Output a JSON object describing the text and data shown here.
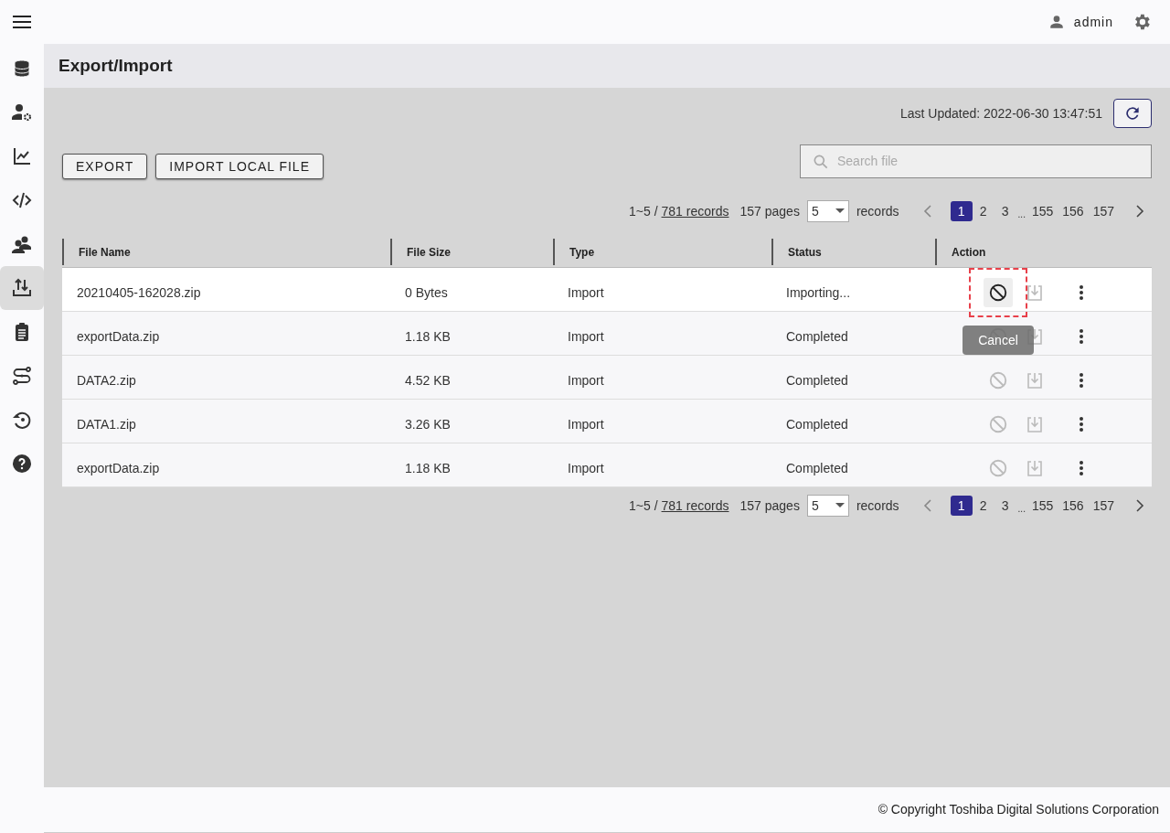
{
  "header": {
    "user": "admin"
  },
  "sidebar": {
    "items": [
      {
        "kind": "database",
        "selected": false
      },
      {
        "kind": "usergear",
        "selected": false
      },
      {
        "kind": "chart",
        "selected": false
      },
      {
        "kind": "code",
        "selected": false
      },
      {
        "kind": "users",
        "selected": false
      },
      {
        "kind": "transfer",
        "selected": true
      },
      {
        "kind": "clipboard",
        "selected": false
      },
      {
        "kind": "route",
        "selected": false
      },
      {
        "kind": "restore",
        "selected": false
      },
      {
        "kind": "help",
        "selected": false
      }
    ]
  },
  "page_title": "Export/Import",
  "last_updated": "Last Updated: 2022-06-30 13:47:51",
  "buttons": [
    "EXPORT",
    "IMPORT LOCAL FILE"
  ],
  "search": {
    "placeholder": "Search file"
  },
  "top_pagination": {
    "range": "1~5 /",
    "records_link": "781 records",
    "pages": "157 pages",
    "page_size": "5",
    "records_label": "records",
    "pages_list": [
      {
        "kind": "page",
        "label": "1",
        "selected": true
      },
      {
        "kind": "page",
        "label": "2",
        "selected": false
      },
      {
        "kind": "page",
        "label": "3",
        "selected": false
      },
      {
        "kind": "ellipsis",
        "label": "..."
      },
      {
        "kind": "page",
        "label": "155",
        "selected": false
      },
      {
        "kind": "page",
        "label": "156",
        "selected": false
      },
      {
        "kind": "page",
        "label": "157",
        "selected": false
      }
    ]
  },
  "table": {
    "columns": [
      "File Name",
      "File Size",
      "Type",
      "Status",
      "Action"
    ],
    "rows": [
      {
        "file_name": "20210405-162028.zip",
        "file_size": "0 Bytes",
        "type": "Import",
        "status": "Importing...",
        "cancel_enabled": true,
        "highlighted": true
      },
      {
        "file_name": "exportData.zip",
        "file_size": "1.18 KB",
        "type": "Import",
        "status": "Completed",
        "cancel_enabled": false,
        "highlighted": false
      },
      {
        "file_name": "DATA2.zip",
        "file_size": "4.52 KB",
        "type": "Import",
        "status": "Completed",
        "cancel_enabled": false,
        "highlighted": false
      },
      {
        "file_name": "DATA1.zip",
        "file_size": "3.26 KB",
        "type": "Import",
        "status": "Completed",
        "cancel_enabled": false,
        "highlighted": false
      },
      {
        "file_name": "exportData.zip",
        "file_size": "1.18 KB",
        "type": "Import",
        "status": "Completed",
        "cancel_enabled": false,
        "highlighted": false
      }
    ]
  },
  "tooltip": {
    "text": "Cancel"
  },
  "bottom_pagination": {
    "range": "1~5 /",
    "records_link": "781 records",
    "pages": "157 pages",
    "page_size": "5",
    "records_label": "records",
    "pages_list": [
      {
        "kind": "page",
        "label": "1",
        "selected": true
      },
      {
        "kind": "page",
        "label": "2",
        "selected": false
      },
      {
        "kind": "page",
        "label": "3",
        "selected": false
      },
      {
        "kind": "ellipsis",
        "label": "..."
      },
      {
        "kind": "page",
        "label": "155",
        "selected": false
      },
      {
        "kind": "page",
        "label": "156",
        "selected": false
      },
      {
        "kind": "page",
        "label": "157",
        "selected": false
      }
    ]
  },
  "footer": "© Copyright Toshiba Digital Solutions Corporation"
}
